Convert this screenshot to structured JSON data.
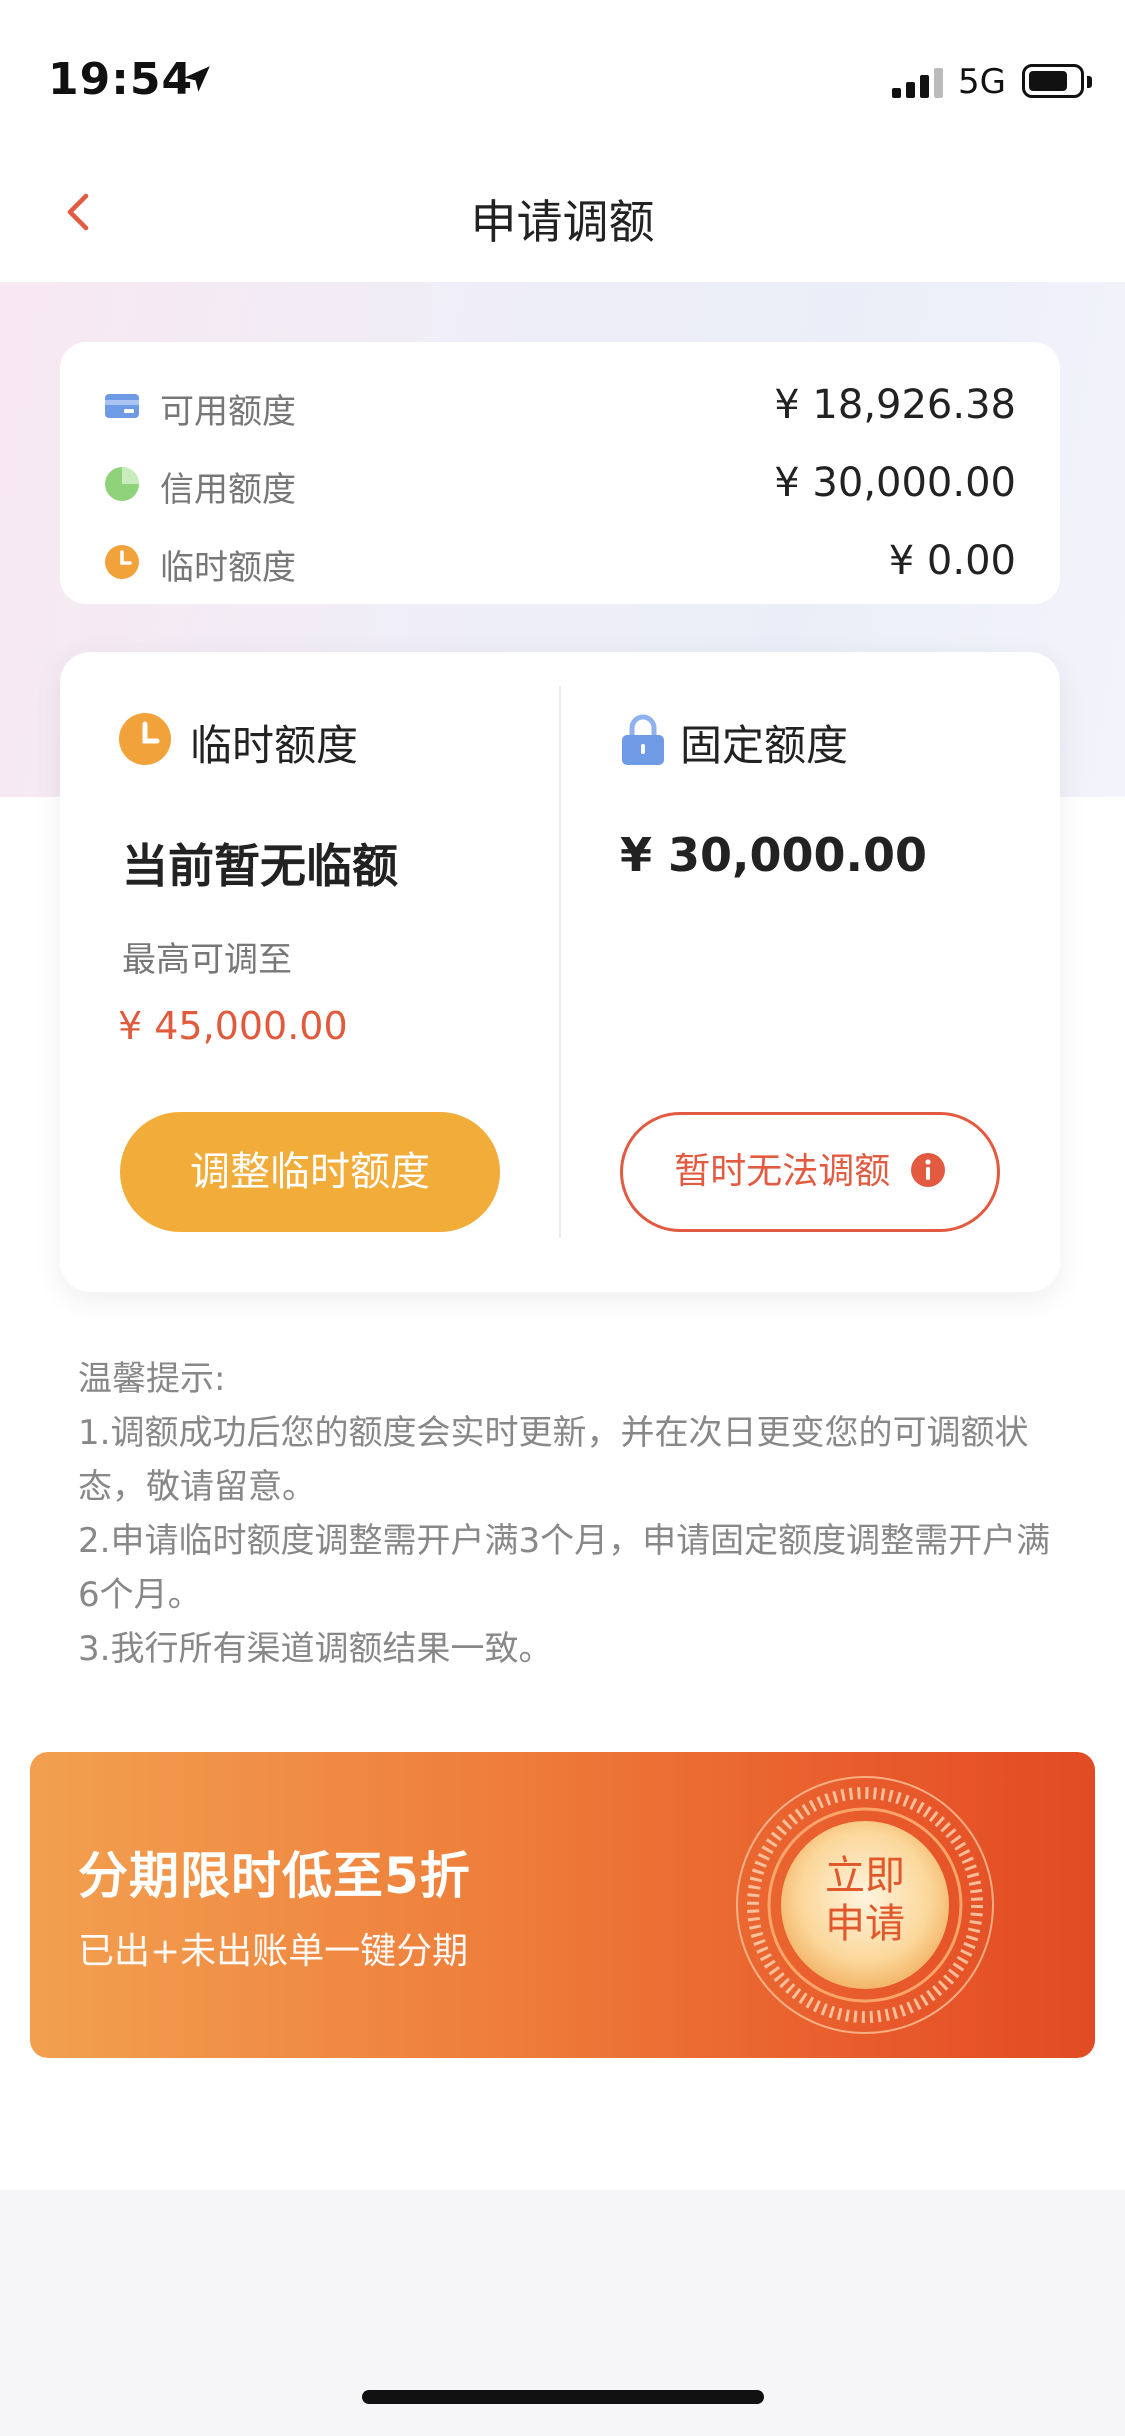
{
  "status_bar": {
    "time": "19:54",
    "network": "5G"
  },
  "navbar": {
    "title": "申请调额"
  },
  "summary": {
    "rows": [
      {
        "label": "可用额度",
        "value": "¥ 18,926.38",
        "icon": "card-icon",
        "color": "#6f9ae6"
      },
      {
        "label": "信用额度",
        "value": "¥ 30,000.00",
        "icon": "pie-icon",
        "color": "#8fd27a"
      },
      {
        "label": "临时额度",
        "value": "¥ 0.00",
        "icon": "clock-icon",
        "color": "#f2a23a"
      }
    ]
  },
  "temporary": {
    "title": "临时额度",
    "status": "当前暂无临额",
    "max_label": "最高可调至",
    "max_value": "¥ 45,000.00",
    "button": "调整临时额度"
  },
  "fixed": {
    "title": "固定额度",
    "value": "¥ 30,000.00",
    "button": "暂时无法调额"
  },
  "tips": {
    "heading": "温馨提示:",
    "items": [
      "1.调额成功后您的额度会实时更新，并在次日更变您的可调额状态，敬请留意。",
      "2.申请临时额度调整需开户满3个月，申请固定额度调整需开户满6个月。",
      "3.我行所有渠道调额结果一致。"
    ]
  },
  "banner": {
    "title": "分期限时低至5折",
    "subtitle": "已出+未出账单一键分期",
    "cta_line1": "立即",
    "cta_line2": "申请"
  },
  "colors": {
    "accent_orange": "#f2ac3a",
    "accent_red": "#e25a3f"
  }
}
